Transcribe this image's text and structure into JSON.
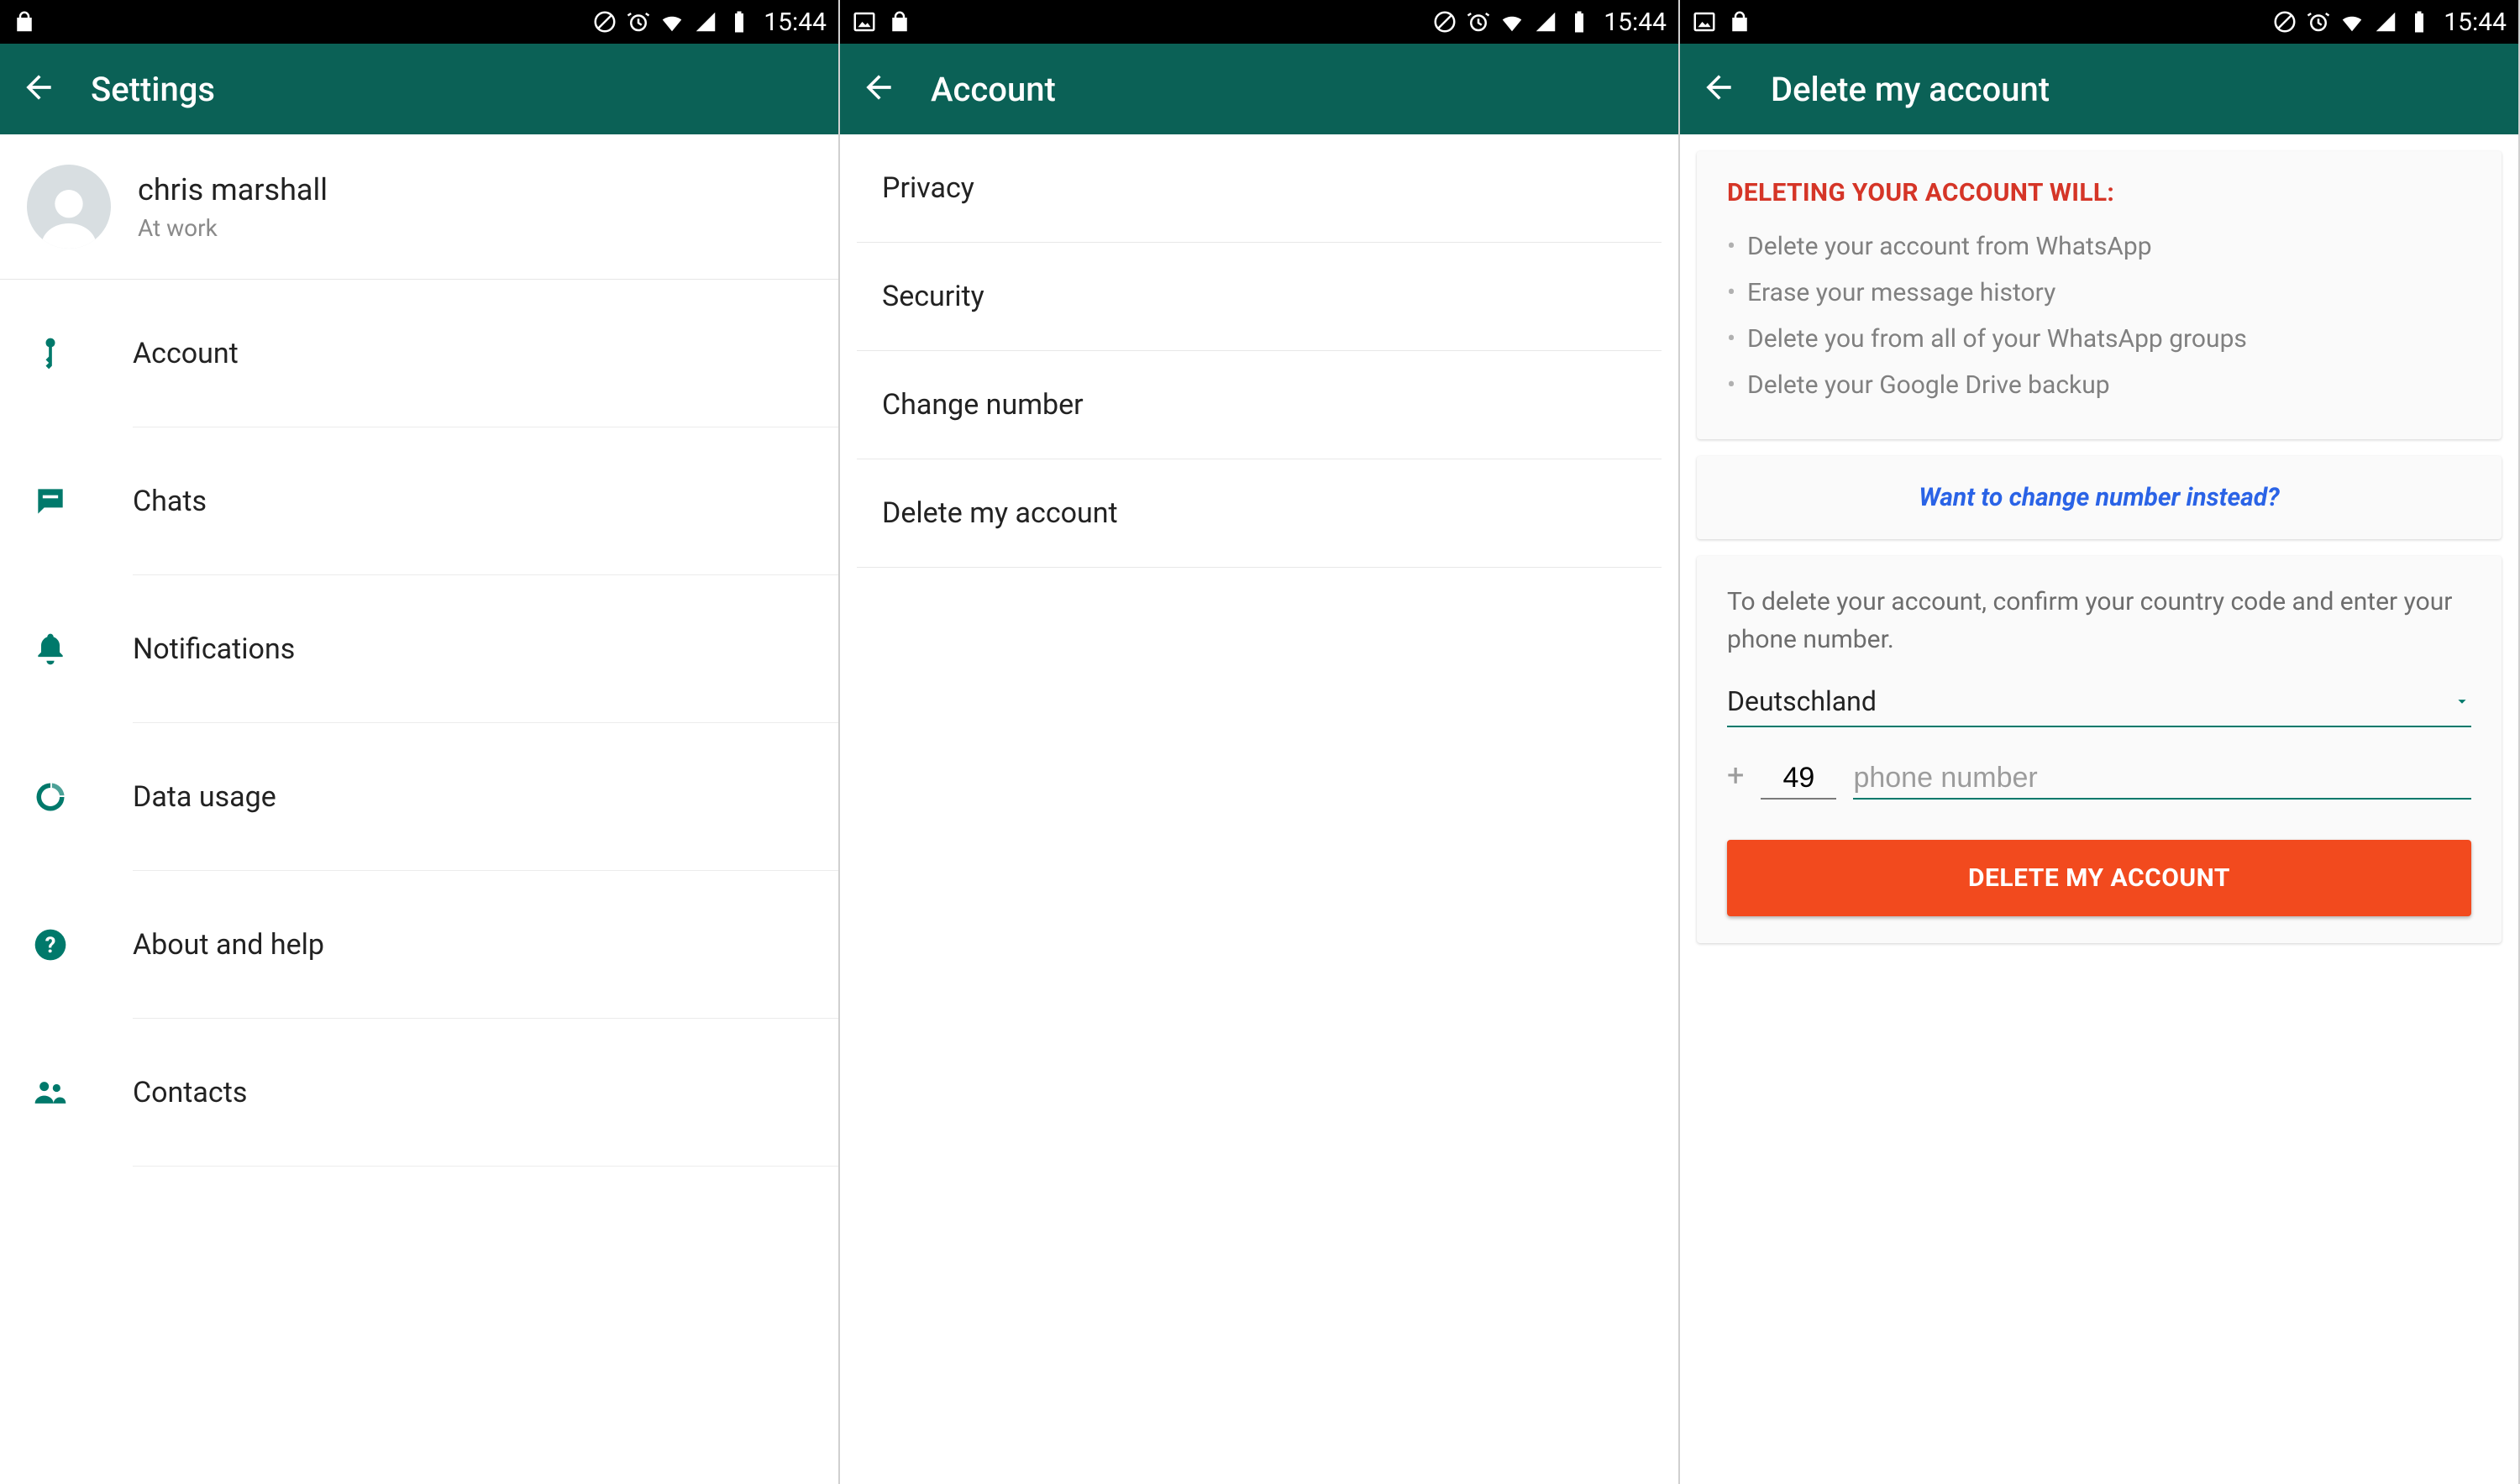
{
  "status_bar": {
    "time": "15:44"
  },
  "screen1": {
    "title": "Settings",
    "profile": {
      "name": "chris marshall",
      "status": "At work"
    },
    "items": [
      {
        "label": "Account"
      },
      {
        "label": "Chats"
      },
      {
        "label": "Notifications"
      },
      {
        "label": "Data usage"
      },
      {
        "label": "About and help"
      },
      {
        "label": "Contacts"
      }
    ]
  },
  "screen2": {
    "title": "Account",
    "items": [
      {
        "label": "Privacy"
      },
      {
        "label": "Security"
      },
      {
        "label": "Change number"
      },
      {
        "label": "Delete my account"
      }
    ]
  },
  "screen3": {
    "title": "Delete my account",
    "warn_title": "DELETING YOUR ACCOUNT WILL:",
    "bullets": [
      "Delete your account from WhatsApp",
      "Erase your message history",
      "Delete you from all of your WhatsApp groups",
      "Delete your Google Drive backup"
    ],
    "change_link": "Want to change number instead?",
    "instruction": "To delete your account, confirm your country code and enter your phone number.",
    "country": "Deutschland",
    "country_code": "49",
    "phone_placeholder": "phone number",
    "delete_button": "DELETE MY ACCOUNT"
  }
}
